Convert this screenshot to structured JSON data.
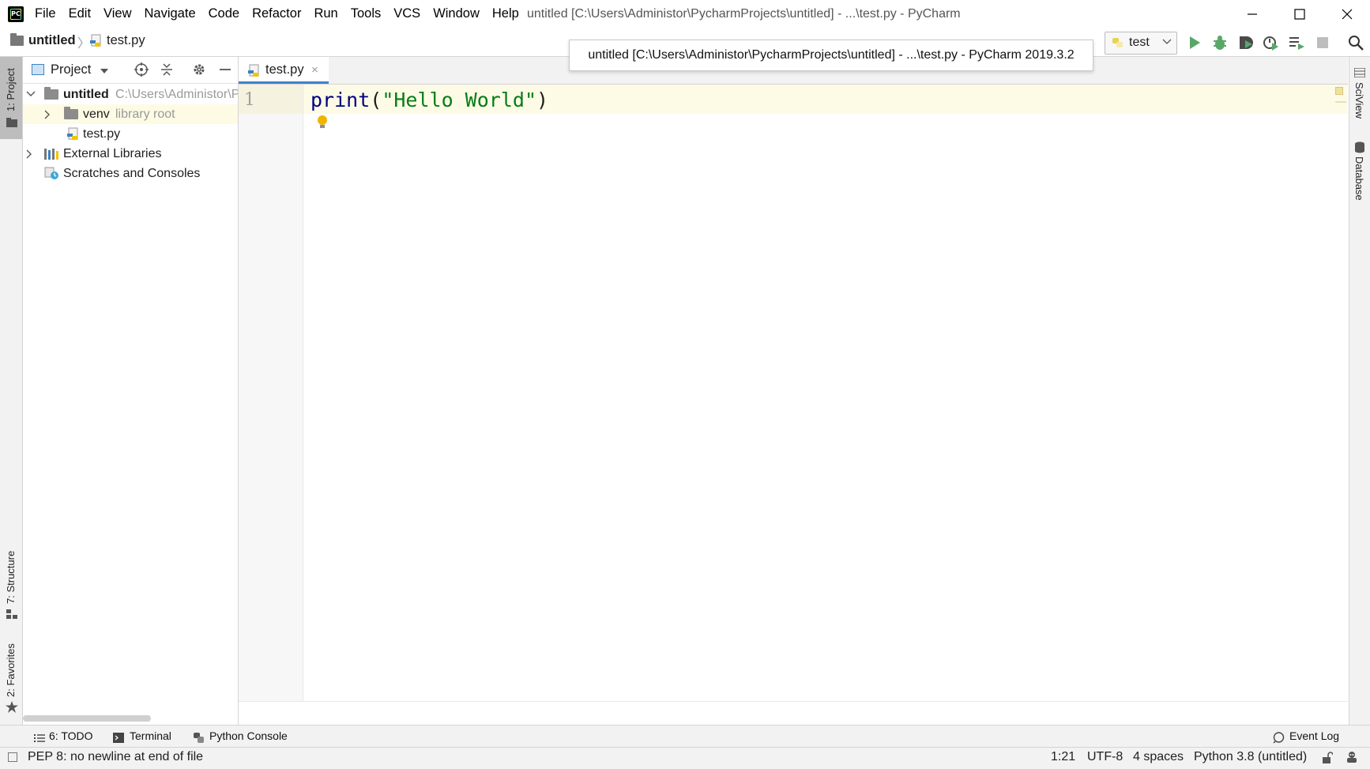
{
  "window": {
    "title": "untitled [C:\\Users\\Administor\\PycharmProjects\\untitled] - ...\\test.py - PyCharm",
    "logo": "pycharm-logo"
  },
  "menu": [
    "File",
    "Edit",
    "View",
    "Navigate",
    "Code",
    "Refactor",
    "Run",
    "Tools",
    "VCS",
    "Window",
    "Help"
  ],
  "breadcrumb": {
    "project": "untitled",
    "separator": "〉",
    "file": "test.py"
  },
  "tooltip": "untitled [C:\\Users\\Administor\\PycharmProjects\\untitled] - ...\\test.py - PyCharm 2019.3.2",
  "run_config": {
    "label": "test"
  },
  "left_strip": {
    "project": "1: Project",
    "structure": "7: Structure",
    "favorites": "2: Favorites"
  },
  "right_strip": {
    "sciview": "SciView",
    "database": "Database"
  },
  "project_panel": {
    "title": "Project",
    "tree": [
      {
        "label": "untitled",
        "hint": "C:\\Users\\Administor\\PycharmProjects\\untitled"
      },
      {
        "label": "venv",
        "hint": "library root"
      },
      {
        "label": "test.py"
      },
      {
        "label": "External Libraries"
      },
      {
        "label": "Scratches and Consoles"
      }
    ]
  },
  "editor": {
    "tab": "test.py",
    "tab_close": "×",
    "line_number": "1",
    "code": {
      "fn": "print",
      "open": "(",
      "str": "\"Hello World\"",
      "close": ")"
    }
  },
  "bottom_tools": {
    "todo": "6: TODO",
    "terminal": "Terminal",
    "python_console": "Python Console",
    "event_log": "Event Log"
  },
  "status": {
    "message": "PEP 8: no newline at end of file",
    "position": "1:21",
    "encoding": "UTF-8",
    "indent": "4 spaces",
    "interpreter": "Python 3.8 (untitled)"
  },
  "colors": {
    "accent": "#4083c9",
    "run_green": "#59a869",
    "string_green": "#067d17",
    "keyword_navy": "#000080",
    "caret_row": "#fdfbe6"
  }
}
